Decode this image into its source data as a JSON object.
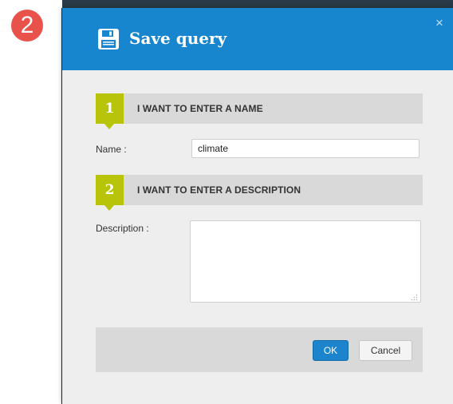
{
  "step_badge": "2",
  "dialog": {
    "title": "Save query",
    "close_glyph": "×",
    "save_icon": "floppy-disk-icon",
    "colors": {
      "header": "#1886cf",
      "section_accent": "#b7c40a",
      "ok_button": "#1c84cc",
      "badge": "#e8524a"
    }
  },
  "sections": [
    {
      "number": "1",
      "label": "I WANT TO ENTER A NAME"
    },
    {
      "number": "2",
      "label": "I WANT TO ENTER A DESCRIPTION"
    }
  ],
  "fields": {
    "name": {
      "label": "Name :",
      "value": "climate"
    },
    "description": {
      "label": "Description :",
      "value": ""
    }
  },
  "buttons": {
    "ok": "OK",
    "cancel": "Cancel"
  }
}
